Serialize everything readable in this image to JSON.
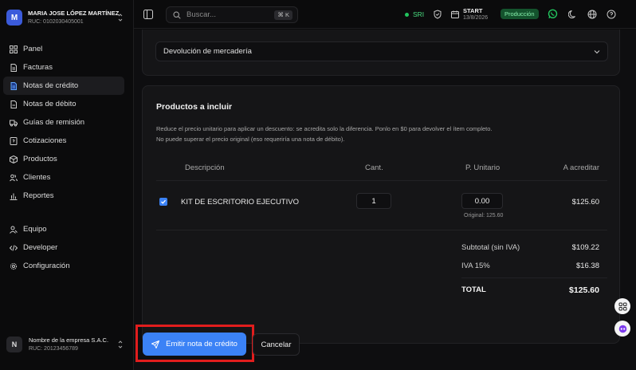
{
  "account": {
    "name": "MARIA JOSE LÓPEZ MARTÍNEZ",
    "ruc": "RUC: 0102030405001",
    "initial": "M"
  },
  "sidebar": {
    "items": [
      {
        "label": "Panel",
        "icon": "grid-icon",
        "active": false
      },
      {
        "label": "Facturas",
        "icon": "invoice-icon",
        "active": false
      },
      {
        "label": "Notas de crédito",
        "icon": "credit-note-icon",
        "active": true
      },
      {
        "label": "Notas de débito",
        "icon": "debit-note-icon",
        "active": false
      },
      {
        "label": "Guías de remisión",
        "icon": "truck-icon",
        "active": false
      },
      {
        "label": "Cotizaciones",
        "icon": "quote-icon",
        "active": false
      },
      {
        "label": "Productos",
        "icon": "box-icon",
        "active": false
      },
      {
        "label": "Clientes",
        "icon": "users-icon",
        "active": false
      },
      {
        "label": "Reportes",
        "icon": "bar-chart-icon",
        "active": false
      }
    ],
    "bottom_items": [
      {
        "label": "Equipo",
        "icon": "team-icon"
      },
      {
        "label": "Developer",
        "icon": "code-icon"
      },
      {
        "label": "Configuración",
        "icon": "gear-icon"
      }
    ]
  },
  "company": {
    "name": "Nombre de la empresa S.A.C.",
    "ruc": "RUC: 20123456789",
    "initial": "N"
  },
  "topbar": {
    "search_placeholder": "Buscar...",
    "shortcut": "⌘ K",
    "sri_label": "SRI",
    "plan_name": "START",
    "plan_date": "13/8/2026",
    "environment": "Producción"
  },
  "form": {
    "reason": "Devolución de mercadería"
  },
  "products": {
    "title": "Productos a incluir",
    "help_line1": "Reduce el precio unitario para aplicar un descuento: se acredita solo la diferencia. Ponlo en $0 para devolver el ítem completo.",
    "help_line2": "No puede superar el precio original (eso requeriría una nota de débito).",
    "columns": [
      "Descripción",
      "Cant.",
      "P. Unitario",
      "A acreditar"
    ],
    "rows": [
      {
        "checked": true,
        "description": "KIT DE ESCRITORIO EJECUTIVO",
        "quantity": "1",
        "unit_price": "0.00",
        "original": "Original: 125.60",
        "credit": "$125.60"
      }
    ],
    "subtotal_label": "Subtotal (sin IVA)",
    "subtotal_value": "$109.22",
    "iva_label": "IVA 15%",
    "iva_value": "$16.38",
    "total_label": "TOTAL",
    "total_value": "$125.60"
  },
  "actions": {
    "emit_label": "Emitir nota de crédito",
    "cancel_label": "Cancelar"
  },
  "colors": {
    "accent": "#3b82f6",
    "success": "#22c55e",
    "highlight": "#e11d1d"
  }
}
